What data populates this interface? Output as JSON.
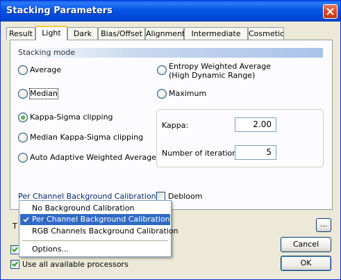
{
  "window": {
    "title": "Stacking Parameters"
  },
  "tabs": [
    {
      "label": "Result"
    },
    {
      "label": "Light"
    },
    {
      "label": "Dark"
    },
    {
      "label": "Bias/Offset"
    },
    {
      "label": "Alignment"
    },
    {
      "label": "Intermediate Files"
    },
    {
      "label": "Cosmetic"
    }
  ],
  "active_tab": "Light",
  "stacking": {
    "header": "Stacking mode",
    "average": "Average",
    "entropy_line1": "Entropy Weighted Average",
    "entropy_line2": "(High Dynamic Range)",
    "median": "Median",
    "maximum": "Maximum",
    "kappa_sigma": "Kappa-Sigma clipping",
    "median_kappa_sigma": "Median Kappa-Sigma clipping",
    "auto_adaptive": "Auto Adaptive Weighted Average",
    "selected": "Kappa-Sigma clipping"
  },
  "kappa": {
    "kappa_label": "Kappa:",
    "kappa_value": "2.00",
    "iterations_label": "Number of iterations:",
    "iterations_value": "5"
  },
  "calibration": {
    "link_label": "Per Channel Background Calibration",
    "debloom_label": "Debloom",
    "debloom_checked": false
  },
  "dropdown_menu": {
    "items": [
      {
        "label": "No Background Calibration"
      },
      {
        "label": "Per Channel Background Calibration"
      },
      {
        "label": "RGB Channels Background Calibration"
      },
      {
        "label": "Options..."
      }
    ],
    "selected": "Per Channel Background Calibration"
  },
  "bottom": {
    "partial_label": "T",
    "use_all_processors": "Use all available processors",
    "use_all_processors_checked": true,
    "hidden_checkbox_checked": true,
    "browse_label": "...",
    "cancel_label": "Cancel",
    "ok_label": "OK"
  },
  "colors": {
    "titlebar": "#0054e3",
    "selection": "#316ac5",
    "tab_highlight": "#ffc73c"
  }
}
